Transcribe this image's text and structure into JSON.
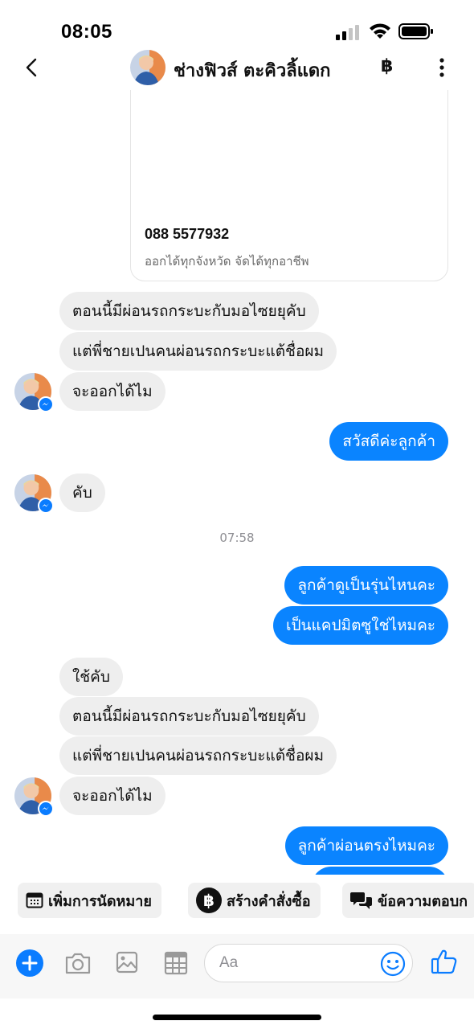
{
  "status_bar": {
    "time": "08:05"
  },
  "header": {
    "contact_name": "ช่างฟิวส์ ตะคิวลิ้แดก",
    "baht_label": "฿"
  },
  "card": {
    "phone": "088 5577932",
    "subtitle": "ออกได้ทุกจังหวัด จัดได้ทุกอาชีพ"
  },
  "messages": [
    {
      "text": "ตอนนี้มีผ่อนรถกระบะกับมอไซยยุคับ",
      "from": "contact"
    },
    {
      "text": "แต่พี่ชายเปนคนผ่อนรถกระบะแต้ชื่อผม",
      "from": "contact"
    },
    {
      "text": "จะออกได้ไม",
      "from": "contact"
    },
    {
      "text": "สวัสดีค่ะลูกค้า",
      "from": "me"
    },
    {
      "text": "คับ",
      "from": "contact"
    },
    {
      "text": "ลูกค้าดูเป็นรุ่นไหนคะ",
      "from": "me"
    },
    {
      "text": "เป็นแคปมิตซูใช่ไหมคะ",
      "from": "me"
    },
    {
      "text": "ใช้คับ",
      "from": "contact"
    },
    {
      "text": "ตอนนี้มีผ่อนรถกระบะกับมอไซยยุคับ",
      "from": "contact"
    },
    {
      "text": "แต่พี่ชายเปนคนผ่อนรถกระบะแต้ชื่อผม",
      "from": "contact"
    },
    {
      "text": "จะออกได้ไม",
      "from": "contact"
    },
    {
      "text": "ลูกค้าผ่อนตรงไหมคะ",
      "from": "me"
    }
  ],
  "timestamp": "07:58",
  "quick_actions": [
    {
      "label": "เพิ่มการนัดหมาย",
      "icon": "calendar-icon"
    },
    {
      "label": "สร้างคำสั่งซื้อ",
      "icon": "baht-icon"
    },
    {
      "label": "ข้อความตอบก",
      "icon": "chat-bubbles-icon"
    }
  ],
  "composer": {
    "placeholder": "Aa",
    "icons": [
      "plus-icon",
      "camera-icon",
      "image-icon",
      "table-icon",
      "emoji-icon",
      "thumbs-up-icon"
    ]
  },
  "colors": {
    "outgoing_bubble": "#0a84ff",
    "incoming_bubble": "#eeeeee",
    "accent": "#0a7cff"
  }
}
